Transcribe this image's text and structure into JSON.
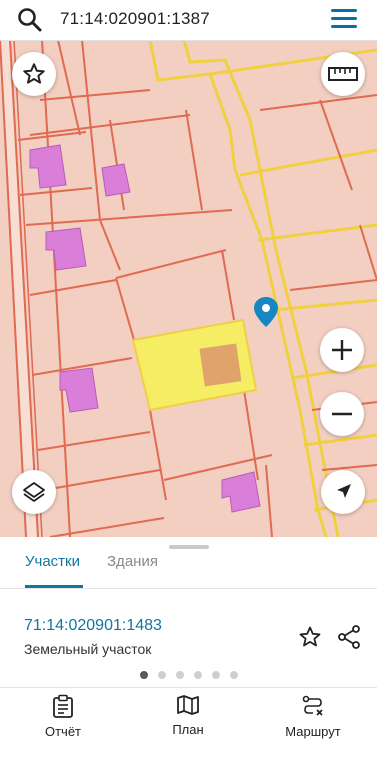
{
  "search": {
    "query": "71:14:020901:1387",
    "icon": "search-icon"
  },
  "header": {
    "menu_icon": "hamburger-menu-icon"
  },
  "map": {
    "colors": {
      "background": "#f2cfc1",
      "parcel_border": "#e06a52",
      "road_border": "#f0d040",
      "building": "#d97ed9",
      "selected_parcel": "#f6ef5f",
      "selected_building": "#e0a36a",
      "marker": "#1787c4"
    },
    "controls": [
      "favorite-star-icon",
      "ruler-icon",
      "zoom-in-icon",
      "zoom-out-icon",
      "layers-icon",
      "navigation-arrow-icon"
    ]
  },
  "sheet": {
    "tabs": [
      "Участки",
      "Здания"
    ],
    "active_tab": "Участки",
    "parcel": {
      "number": "71:14:020901:1483",
      "type": "Земельный участок"
    },
    "pagination_total": 6,
    "pagination_active": 1
  },
  "bottom_nav": [
    {
      "label": "Отчёт",
      "icon": "report-clipboard-icon"
    },
    {
      "label": "План",
      "icon": "map-plan-icon"
    },
    {
      "label": "Маршрут",
      "icon": "route-icon"
    }
  ]
}
